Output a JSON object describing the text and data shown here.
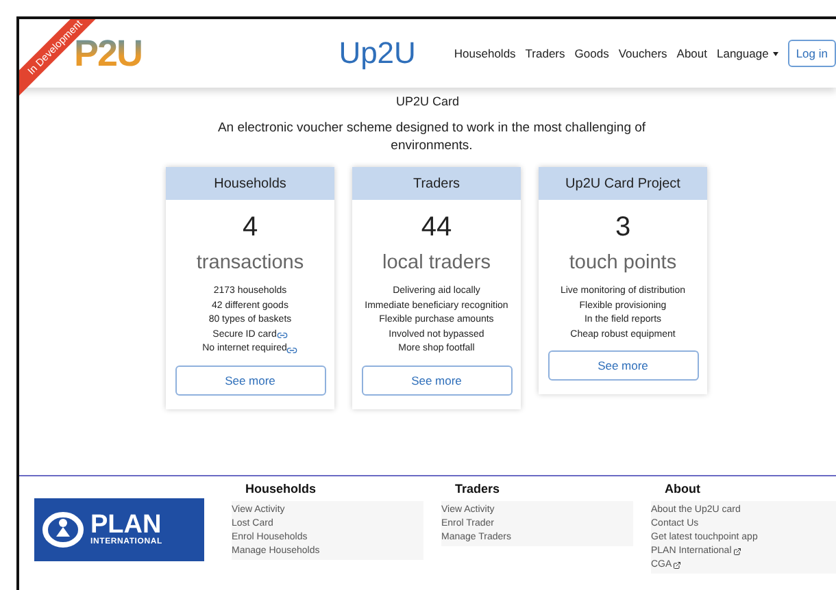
{
  "header": {
    "logo_text": "P2U",
    "ribbon": "In Development",
    "title": "Up2U",
    "nav": [
      {
        "label": "Households",
        "kind": "link"
      },
      {
        "label": "Traders",
        "kind": "link"
      },
      {
        "label": "Goods",
        "kind": "link"
      },
      {
        "label": "Vouchers",
        "kind": "link"
      },
      {
        "label": "About",
        "kind": "link"
      },
      {
        "label": "Language",
        "kind": "dropdown"
      }
    ],
    "login": "Log in"
  },
  "intro": {
    "heading": "UP2U Card",
    "text": "An electronic voucher scheme designed to work in the most challenging of environments."
  },
  "cards": [
    {
      "title": "Households",
      "number": "4",
      "unit": "transactions",
      "items": [
        {
          "text": "2173 households",
          "linked": false
        },
        {
          "text": "42 different goods",
          "linked": false
        },
        {
          "text": "80 types of baskets",
          "linked": false
        },
        {
          "text": "Secure ID card",
          "linked": true
        },
        {
          "text": "No internet required ",
          "linked": true
        }
      ],
      "button": "See more"
    },
    {
      "title": "Traders",
      "number": "44",
      "unit": "local traders",
      "items": [
        {
          "text": "Delivering aid locally",
          "linked": false
        },
        {
          "text": "Immediate beneficiary recognition",
          "linked": false
        },
        {
          "text": "Flexible purchase amounts",
          "linked": false
        },
        {
          "text": "Involved not bypassed",
          "linked": false
        },
        {
          "text": "More shop footfall",
          "linked": false
        }
      ],
      "button": "See more"
    },
    {
      "title": "Up2U Card Project",
      "number": "3",
      "unit": "touch points",
      "items": [
        {
          "text": "Live monitoring of distribution",
          "linked": false
        },
        {
          "text": "Flexible provisioning",
          "linked": false
        },
        {
          "text": "In the field reports",
          "linked": false
        },
        {
          "text": "Cheap robust equipment",
          "linked": false
        }
      ],
      "button": "See more"
    }
  ],
  "footer": {
    "logo": {
      "name": "PLAN",
      "sub": "INTERNATIONAL"
    },
    "columns": [
      {
        "heading": "Households",
        "links": [
          {
            "text": "View Activity",
            "external": false
          },
          {
            "text": "Lost Card",
            "external": false
          },
          {
            "text": "Enrol Households",
            "external": false
          },
          {
            "text": "Manage Households",
            "external": false
          }
        ]
      },
      {
        "heading": "Traders",
        "links": [
          {
            "text": "View Activity",
            "external": false
          },
          {
            "text": "Enrol Trader",
            "external": false
          },
          {
            "text": "Manage Traders",
            "external": false
          }
        ]
      },
      {
        "heading": "About",
        "links": [
          {
            "text": "About the Up2U card",
            "external": false
          },
          {
            "text": "Contact Us",
            "external": false
          },
          {
            "text": "Get latest touchpoint app",
            "external": false
          },
          {
            "text": "PLAN International",
            "external": true
          },
          {
            "text": "CGA",
            "external": true
          }
        ]
      }
    ]
  }
}
